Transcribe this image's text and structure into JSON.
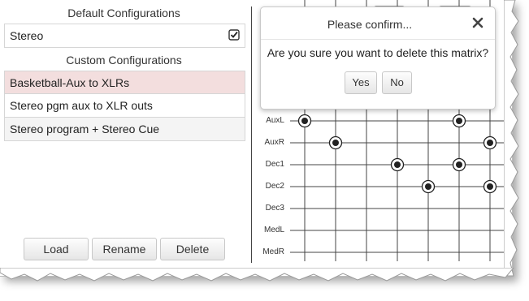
{
  "default_section": {
    "title": "Default Configurations",
    "items": [
      {
        "label": "Stereo",
        "checked": true
      }
    ]
  },
  "custom_section": {
    "title": "Custom Configurations",
    "items": [
      {
        "label": "Basketball-Aux to XLRs",
        "selected": true
      },
      {
        "label": "Stereo pgm aux to XLR outs",
        "selected": false
      },
      {
        "label": "Stereo program + Stereo Cue",
        "selected": false
      }
    ]
  },
  "buttons": {
    "load": "Load",
    "rename": "Rename",
    "delete": "Delete"
  },
  "matrix": {
    "rows": [
      "AuxL",
      "AuxR",
      "Dec1",
      "Dec2",
      "Dec3",
      "MedL",
      "MedR"
    ],
    "connections": [
      {
        "row": 0,
        "col": 0
      },
      {
        "row": 0,
        "col": 5
      },
      {
        "row": 1,
        "col": 1
      },
      {
        "row": 1,
        "col": 6
      },
      {
        "row": 2,
        "col": 3
      },
      {
        "row": 2,
        "col": 5
      },
      {
        "row": 3,
        "col": 4
      },
      {
        "row": 3,
        "col": 6
      }
    ]
  },
  "dialog": {
    "title": "Please confirm...",
    "message": "Are you sure you want to delete this matrix?",
    "yes": "Yes",
    "no": "No"
  },
  "colors": {
    "selected_row": "#f3dede",
    "grid_line": "#444444"
  }
}
